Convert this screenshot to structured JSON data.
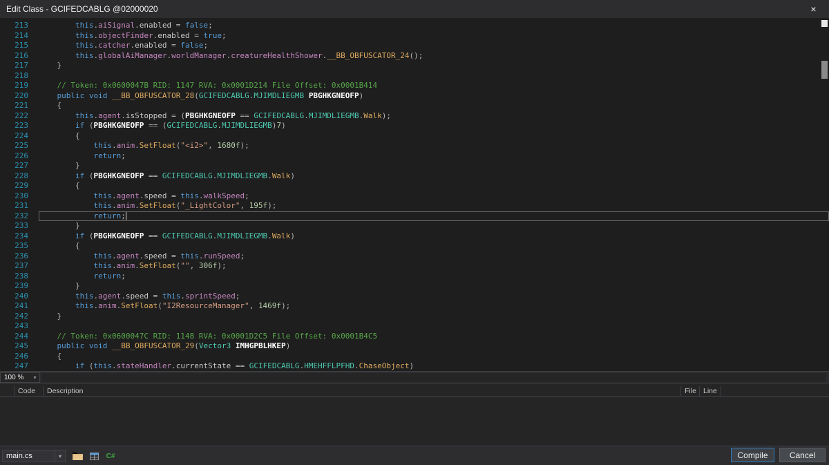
{
  "titlebar": {
    "title": "Edit Class - GCIFEDCABLG @02000020",
    "close": "×"
  },
  "editor": {
    "zoom": "100 %",
    "lines": [
      {
        "n": "213",
        "t": [
          [
            "p",
            "        "
          ],
          [
            "kw",
            "this"
          ],
          [
            "p",
            "."
          ],
          [
            "fld",
            "aiSignal"
          ],
          [
            "p",
            "."
          ],
          [
            "prop",
            "enabled"
          ],
          [
            "p",
            " = "
          ],
          [
            "kw",
            "false"
          ],
          [
            "p",
            ";"
          ]
        ]
      },
      {
        "n": "214",
        "t": [
          [
            "p",
            "        "
          ],
          [
            "kw",
            "this"
          ],
          [
            "p",
            "."
          ],
          [
            "fld",
            "objectFinder"
          ],
          [
            "p",
            "."
          ],
          [
            "prop",
            "enabled"
          ],
          [
            "p",
            " = "
          ],
          [
            "kw",
            "true"
          ],
          [
            "p",
            ";"
          ]
        ]
      },
      {
        "n": "215",
        "t": [
          [
            "p",
            "        "
          ],
          [
            "kw",
            "this"
          ],
          [
            "p",
            "."
          ],
          [
            "fld",
            "catcher"
          ],
          [
            "p",
            "."
          ],
          [
            "prop",
            "enabled"
          ],
          [
            "p",
            " = "
          ],
          [
            "kw",
            "false"
          ],
          [
            "p",
            ";"
          ]
        ]
      },
      {
        "n": "216",
        "t": [
          [
            "p",
            "        "
          ],
          [
            "kw",
            "this"
          ],
          [
            "p",
            "."
          ],
          [
            "fld",
            "globalAiManager"
          ],
          [
            "p",
            "."
          ],
          [
            "fld",
            "worldManager"
          ],
          [
            "p",
            "."
          ],
          [
            "fld",
            "creatureHealthShower"
          ],
          [
            "p",
            "."
          ],
          [
            "mth",
            "__BB_OBFUSCATOR_24"
          ],
          [
            "p",
            "();"
          ]
        ]
      },
      {
        "n": "217",
        "t": [
          [
            "p",
            "    }"
          ]
        ]
      },
      {
        "n": "218",
        "t": []
      },
      {
        "n": "219",
        "t": [
          [
            "com",
            "    // Token: 0x0600047B RID: 1147 RVA: 0x0001D214 File Offset: 0x0001B414"
          ]
        ]
      },
      {
        "n": "220",
        "t": [
          [
            "p",
            "    "
          ],
          [
            "kw",
            "public"
          ],
          [
            "p",
            " "
          ],
          [
            "kw",
            "void"
          ],
          [
            "p",
            " "
          ],
          [
            "mth",
            "__BB_OBFUSCATOR_28"
          ],
          [
            "p",
            "("
          ],
          [
            "typ",
            "GCIFEDCABLG"
          ],
          [
            "p",
            "."
          ],
          [
            "typ",
            "MJIMDLIEGMB"
          ],
          [
            "p",
            " "
          ],
          [
            "par",
            "PBGHKGNEOFP"
          ],
          [
            "p",
            ")"
          ]
        ]
      },
      {
        "n": "221",
        "t": [
          [
            "p",
            "    {"
          ]
        ]
      },
      {
        "n": "222",
        "t": [
          [
            "p",
            "        "
          ],
          [
            "kw",
            "this"
          ],
          [
            "p",
            "."
          ],
          [
            "fld",
            "agent"
          ],
          [
            "p",
            "."
          ],
          [
            "prop",
            "isStopped"
          ],
          [
            "p",
            " = ("
          ],
          [
            "par",
            "PBGHKGNEOFP"
          ],
          [
            "p",
            " == "
          ],
          [
            "typ",
            "GCIFEDCABLG"
          ],
          [
            "p",
            "."
          ],
          [
            "typ",
            "MJIMDLIEGMB"
          ],
          [
            "p",
            "."
          ],
          [
            "enm",
            "Walk"
          ],
          [
            "p",
            ");"
          ]
        ]
      },
      {
        "n": "223",
        "t": [
          [
            "p",
            "        "
          ],
          [
            "kw",
            "if"
          ],
          [
            "p",
            " ("
          ],
          [
            "par",
            "PBGHKGNEOFP"
          ],
          [
            "p",
            " == ("
          ],
          [
            "typ",
            "GCIFEDCABLG"
          ],
          [
            "p",
            "."
          ],
          [
            "typ",
            "MJIMDLIEGMB"
          ],
          [
            "p",
            ")"
          ],
          [
            "num",
            "7"
          ],
          [
            "p",
            ")"
          ]
        ]
      },
      {
        "n": "224",
        "t": [
          [
            "p",
            "        {"
          ]
        ]
      },
      {
        "n": "225",
        "t": [
          [
            "p",
            "            "
          ],
          [
            "kw",
            "this"
          ],
          [
            "p",
            "."
          ],
          [
            "fld",
            "anim"
          ],
          [
            "p",
            "."
          ],
          [
            "mth",
            "SetFloat"
          ],
          [
            "p",
            "("
          ],
          [
            "str",
            "\"<i2>\""
          ],
          [
            "p",
            ", "
          ],
          [
            "num",
            "1680f"
          ],
          [
            "p",
            ");"
          ]
        ]
      },
      {
        "n": "226",
        "t": [
          [
            "p",
            "            "
          ],
          [
            "kw",
            "return"
          ],
          [
            "p",
            ";"
          ]
        ]
      },
      {
        "n": "227",
        "t": [
          [
            "p",
            "        }"
          ]
        ]
      },
      {
        "n": "228",
        "t": [
          [
            "p",
            "        "
          ],
          [
            "kw",
            "if"
          ],
          [
            "p",
            " ("
          ],
          [
            "par",
            "PBGHKGNEOFP"
          ],
          [
            "p",
            " == "
          ],
          [
            "typ",
            "GCIFEDCABLG"
          ],
          [
            "p",
            "."
          ],
          [
            "typ",
            "MJIMDLIEGMB"
          ],
          [
            "p",
            "."
          ],
          [
            "enm",
            "Walk"
          ],
          [
            "p",
            ")"
          ]
        ]
      },
      {
        "n": "229",
        "t": [
          [
            "p",
            "        {"
          ]
        ]
      },
      {
        "n": "230",
        "t": [
          [
            "p",
            "            "
          ],
          [
            "kw",
            "this"
          ],
          [
            "p",
            "."
          ],
          [
            "fld",
            "agent"
          ],
          [
            "p",
            "."
          ],
          [
            "prop",
            "speed"
          ],
          [
            "p",
            " = "
          ],
          [
            "kw",
            "this"
          ],
          [
            "p",
            "."
          ],
          [
            "fld",
            "walkSpeed"
          ],
          [
            "p",
            ";"
          ]
        ]
      },
      {
        "n": "231",
        "t": [
          [
            "p",
            "            "
          ],
          [
            "kw",
            "this"
          ],
          [
            "p",
            "."
          ],
          [
            "fld",
            "anim"
          ],
          [
            "p",
            "."
          ],
          [
            "mth",
            "SetFloat"
          ],
          [
            "p",
            "("
          ],
          [
            "str",
            "\"_LightColor\""
          ],
          [
            "p",
            ", "
          ],
          [
            "num",
            "195f"
          ],
          [
            "p",
            ");"
          ]
        ]
      },
      {
        "n": "232",
        "cur": true,
        "caret": true,
        "t": [
          [
            "p",
            "            "
          ],
          [
            "kw",
            "return"
          ],
          [
            "p",
            ";"
          ]
        ]
      },
      {
        "n": "233",
        "t": [
          [
            "p",
            "        }"
          ]
        ]
      },
      {
        "n": "234",
        "t": [
          [
            "p",
            "        "
          ],
          [
            "kw",
            "if"
          ],
          [
            "p",
            " ("
          ],
          [
            "par",
            "PBGHKGNEOFP"
          ],
          [
            "p",
            " == "
          ],
          [
            "typ",
            "GCIFEDCABLG"
          ],
          [
            "p",
            "."
          ],
          [
            "typ",
            "MJIMDLIEGMB"
          ],
          [
            "p",
            "."
          ],
          [
            "enm",
            "Walk"
          ],
          [
            "p",
            ")"
          ]
        ]
      },
      {
        "n": "235",
        "t": [
          [
            "p",
            "        {"
          ]
        ]
      },
      {
        "n": "236",
        "t": [
          [
            "p",
            "            "
          ],
          [
            "kw",
            "this"
          ],
          [
            "p",
            "."
          ],
          [
            "fld",
            "agent"
          ],
          [
            "p",
            "."
          ],
          [
            "prop",
            "speed"
          ],
          [
            "p",
            " = "
          ],
          [
            "kw",
            "this"
          ],
          [
            "p",
            "."
          ],
          [
            "fld",
            "runSpeed"
          ],
          [
            "p",
            ";"
          ]
        ]
      },
      {
        "n": "237",
        "t": [
          [
            "p",
            "            "
          ],
          [
            "kw",
            "this"
          ],
          [
            "p",
            "."
          ],
          [
            "fld",
            "anim"
          ],
          [
            "p",
            "."
          ],
          [
            "mth",
            "SetFloat"
          ],
          [
            "p",
            "("
          ],
          [
            "str",
            "\"\""
          ],
          [
            "p",
            ", "
          ],
          [
            "num",
            "306f"
          ],
          [
            "p",
            ");"
          ]
        ]
      },
      {
        "n": "238",
        "t": [
          [
            "p",
            "            "
          ],
          [
            "kw",
            "return"
          ],
          [
            "p",
            ";"
          ]
        ]
      },
      {
        "n": "239",
        "t": [
          [
            "p",
            "        }"
          ]
        ]
      },
      {
        "n": "240",
        "t": [
          [
            "p",
            "        "
          ],
          [
            "kw",
            "this"
          ],
          [
            "p",
            "."
          ],
          [
            "fld",
            "agent"
          ],
          [
            "p",
            "."
          ],
          [
            "prop",
            "speed"
          ],
          [
            "p",
            " = "
          ],
          [
            "kw",
            "this"
          ],
          [
            "p",
            "."
          ],
          [
            "fld",
            "sprintSpeed"
          ],
          [
            "p",
            ";"
          ]
        ]
      },
      {
        "n": "241",
        "t": [
          [
            "p",
            "        "
          ],
          [
            "kw",
            "this"
          ],
          [
            "p",
            "."
          ],
          [
            "fld",
            "anim"
          ],
          [
            "p",
            "."
          ],
          [
            "mth",
            "SetFloat"
          ],
          [
            "p",
            "("
          ],
          [
            "str",
            "\"I2ResourceManager\""
          ],
          [
            "p",
            ", "
          ],
          [
            "num",
            "1469f"
          ],
          [
            "p",
            ");"
          ]
        ]
      },
      {
        "n": "242",
        "t": [
          [
            "p",
            "    }"
          ]
        ]
      },
      {
        "n": "243",
        "t": []
      },
      {
        "n": "244",
        "t": [
          [
            "com",
            "    // Token: 0x0600047C RID: 1148 RVA: 0x0001D2C5 File Offset: 0x0001B4C5"
          ]
        ]
      },
      {
        "n": "245",
        "t": [
          [
            "p",
            "    "
          ],
          [
            "kw",
            "public"
          ],
          [
            "p",
            " "
          ],
          [
            "kw",
            "void"
          ],
          [
            "p",
            " "
          ],
          [
            "mth",
            "__BB_OBFUSCATOR_29"
          ],
          [
            "p",
            "("
          ],
          [
            "typ",
            "Vector3"
          ],
          [
            "p",
            " "
          ],
          [
            "par",
            "IMHGPBLHKEP"
          ],
          [
            "p",
            ")"
          ]
        ]
      },
      {
        "n": "246",
        "t": [
          [
            "p",
            "    {"
          ]
        ]
      },
      {
        "n": "247",
        "t": [
          [
            "p",
            "        "
          ],
          [
            "kw",
            "if"
          ],
          [
            "p",
            " ("
          ],
          [
            "kw",
            "this"
          ],
          [
            "p",
            "."
          ],
          [
            "fld",
            "stateHandler"
          ],
          [
            "p",
            "."
          ],
          [
            "prop",
            "currentState"
          ],
          [
            "p",
            " == "
          ],
          [
            "typ",
            "GCIFEDCABLG"
          ],
          [
            "p",
            "."
          ],
          [
            "typ",
            "HMEHFFLPFHD"
          ],
          [
            "p",
            "."
          ],
          [
            "enm",
            "ChaseObject"
          ],
          [
            "p",
            ")"
          ]
        ]
      }
    ]
  },
  "error_list": {
    "columns": [
      "Code",
      "Description",
      "File",
      "Line"
    ]
  },
  "footer": {
    "file": "main.cs",
    "combo_arrow": "▾",
    "csharp_label": "C#",
    "icons": [
      "open-folder-icon",
      "add-reference-icon",
      "csharp-file-icon"
    ],
    "compile": "Compile",
    "cancel": "Cancel"
  },
  "colors": {
    "accent_blue": "#2f81c7",
    "editor_bg": "#1e1e1e",
    "chrome_bg": "#2d2d30",
    "line_number": "#2b91af"
  }
}
